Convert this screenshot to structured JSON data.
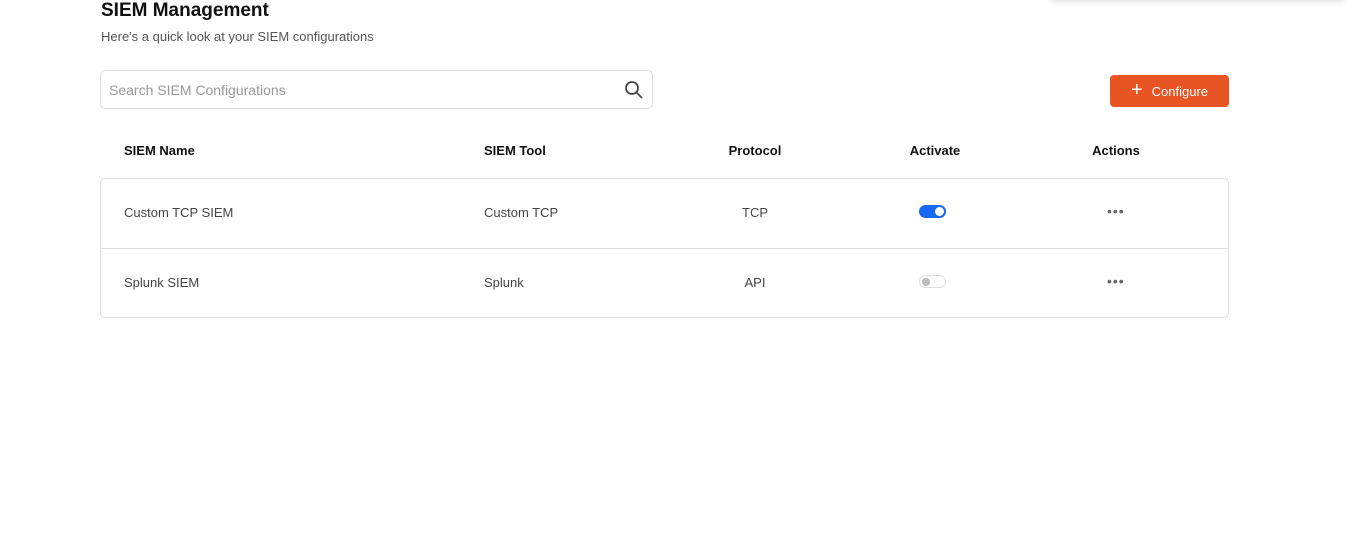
{
  "header": {
    "title": "SIEM Management",
    "subtitle": "Here's a quick look at your SIEM configurations"
  },
  "search": {
    "placeholder": "Search SIEM Configurations",
    "value": ""
  },
  "toolbar": {
    "configure_label": "Configure"
  },
  "table": {
    "columns": [
      "SIEM Name",
      "SIEM Tool",
      "Protocol",
      "Activate",
      "Actions"
    ],
    "rows": [
      {
        "name": "Custom TCP SIEM",
        "tool": "Custom TCP",
        "protocol": "TCP",
        "active": true,
        "actions": "•••"
      },
      {
        "name": "Splunk SIEM",
        "tool": "Splunk",
        "protocol": "API",
        "active": false,
        "actions": "•••"
      }
    ]
  },
  "colors": {
    "accent": "#e95425",
    "toggle_on": "#1669f2"
  }
}
